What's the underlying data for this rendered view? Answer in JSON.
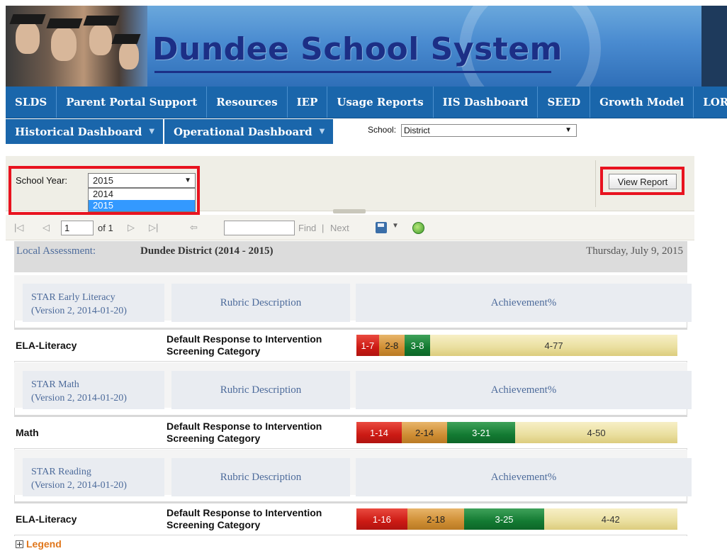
{
  "banner": {
    "title": "Dundee School System"
  },
  "main_nav": [
    {
      "label": "SLDS"
    },
    {
      "label": "Parent Portal Support"
    },
    {
      "label": "Resources"
    },
    {
      "label": "IEP"
    },
    {
      "label": "Usage Reports"
    },
    {
      "label": "IIS Dashboard"
    },
    {
      "label": "SEED"
    },
    {
      "label": "Growth Model"
    },
    {
      "label": "LOR"
    }
  ],
  "sub_nav": [
    {
      "label": "Historical Dashboard"
    },
    {
      "label": "Operational Dashboard"
    }
  ],
  "school_filter": {
    "label": "School:",
    "value": "District"
  },
  "params": {
    "year_label": "School Year:",
    "year_value": "2015",
    "year_options": [
      "2014",
      "2015"
    ],
    "view_report_label": "View Report"
  },
  "toolbar": {
    "page_value": "1",
    "of_label": "of 1",
    "find_label": "Find",
    "separator": "|",
    "next_label": "Next"
  },
  "report": {
    "local_label": "Local Assessment:",
    "district": "Dundee District (2014 - 2015)",
    "date": "Thursday, July 9, 2015",
    "sections": [
      {
        "assessment": "STAR Early Literacy",
        "version": "(Version 2, 2014-01-20)",
        "rubric_header": "Rubric Description",
        "achievement_header": "Achievement%",
        "subject": "ELA-Literacy",
        "rubric": "Default Response to Intervention Screening Category",
        "segments": [
          {
            "label": "1-7",
            "value": 7,
            "color": "#cc1a14"
          },
          {
            "label": "2-8",
            "value": 8,
            "color": "#cf8e34"
          },
          {
            "label": "3-8",
            "value": 8,
            "color": "#137a32"
          },
          {
            "label": "4-77",
            "value": 77,
            "color": "#eadf9f"
          }
        ]
      },
      {
        "assessment": "STAR Math",
        "version": "(Version 2, 2014-01-20)",
        "rubric_header": "Rubric Description",
        "achievement_header": "Achievement%",
        "subject": "Math",
        "rubric": "Default Response to Intervention Screening Category",
        "segments": [
          {
            "label": "1-14",
            "value": 14,
            "color": "#cc1a14"
          },
          {
            "label": "2-14",
            "value": 14,
            "color": "#cf8e34"
          },
          {
            "label": "3-21",
            "value": 21,
            "color": "#137a32"
          },
          {
            "label": "4-50",
            "value": 50,
            "color": "#eadf9f"
          }
        ]
      },
      {
        "assessment": "STAR Reading",
        "version": "(Version 2, 2014-01-20)",
        "rubric_header": "Rubric Description",
        "achievement_header": "Achievement%",
        "subject": "ELA-Literacy",
        "rubric": "Default Response to Intervention Screening Category",
        "segments": [
          {
            "label": "1-16",
            "value": 16,
            "color": "#cc1a14"
          },
          {
            "label": "2-18",
            "value": 18,
            "color": "#cf8e34"
          },
          {
            "label": "3-25",
            "value": 25,
            "color": "#137a32"
          },
          {
            "label": "4-42",
            "value": 42,
            "color": "#eadf9f"
          }
        ]
      }
    ]
  },
  "legend_label": "Legend"
}
